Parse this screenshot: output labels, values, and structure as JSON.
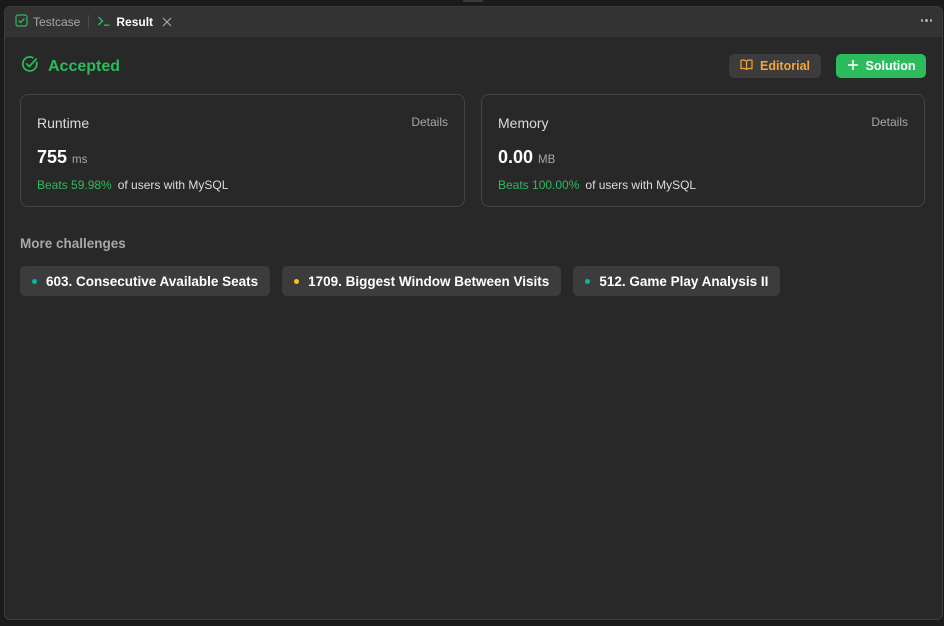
{
  "tabs": {
    "testcase_label": "Testcase",
    "result_label": "Result"
  },
  "result": {
    "status": "Accepted",
    "editorial_label": "Editorial",
    "solution_label": "Solution"
  },
  "runtime": {
    "title": "Runtime",
    "details_label": "Details",
    "value": "755",
    "unit": "ms",
    "beats": "Beats 59.98%",
    "beats_rest": "of users with MySQL"
  },
  "memory": {
    "title": "Memory",
    "details_label": "Details",
    "value": "0.00",
    "unit": "MB",
    "beats": "Beats 100.00%",
    "beats_rest": "of users with MySQL"
  },
  "more_challenges": {
    "title": "More challenges",
    "items": [
      {
        "label": "603. Consecutive Available Seats",
        "difficulty_color": "#00b8a3"
      },
      {
        "label": "1709. Biggest Window Between Visits",
        "difficulty_color": "#ffc01e"
      },
      {
        "label": "512. Game Play Analysis II",
        "difficulty_color": "#00b8a3"
      }
    ]
  },
  "colors": {
    "accent_green": "#2cbb5d",
    "editorial_orange": "#f4a536"
  }
}
